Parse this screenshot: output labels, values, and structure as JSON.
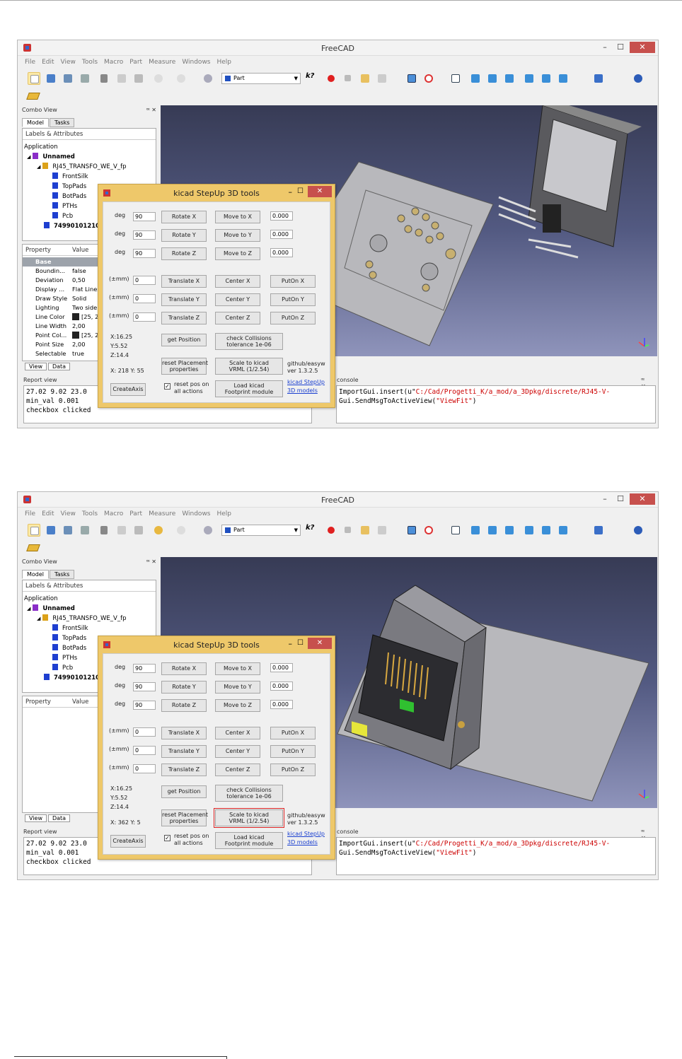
{
  "window": {
    "title": "FreeCAD",
    "min": "–",
    "max": "☐",
    "close": "✕"
  },
  "menu": [
    "File",
    "Edit",
    "View",
    "Tools",
    "Macro",
    "Part",
    "Measure",
    "Windows",
    "Help"
  ],
  "toolbar": {
    "workbench": "Part"
  },
  "combo_view": {
    "title": "Combo View",
    "buttons": "ꟹ ✕",
    "tabs": [
      "Model",
      "Tasks"
    ],
    "tree_header": "Labels & Attributes",
    "tree": {
      "application": "Application",
      "document": "Unnamed",
      "part": "RJ45_TRANSFO_WE_V_fp",
      "children": [
        "FrontSilk",
        "TopPads",
        "BotPads",
        "PTHs",
        "Pcb"
      ],
      "shape": "74990101210"
    },
    "property_header": {
      "property": "Property",
      "value": "Value"
    },
    "properties": [
      {
        "name": "Base",
        "value": ""
      },
      {
        "name": "Boundin...",
        "value": "false"
      },
      {
        "name": "Deviation",
        "value": "0,50"
      },
      {
        "name": "Display ...",
        "value": "Flat Lines"
      },
      {
        "name": "Draw Style",
        "value": "Solid"
      },
      {
        "name": "Lighting",
        "value": "Two side"
      },
      {
        "name": "Line Color",
        "value": "[25, 2"
      },
      {
        "name": "Line Width",
        "value": "2,00"
      },
      {
        "name": "Point Col...",
        "value": "[25, 2"
      },
      {
        "name": "Point Size",
        "value": "2,00"
      },
      {
        "name": "Selectable",
        "value": "true"
      }
    ],
    "bottom_tabs": [
      "View",
      "Data"
    ]
  },
  "report": {
    "title": "Report view",
    "lines": [
      "27.02 9.02 23.0",
      "min_val 0.001",
      "checkbox clicked"
    ]
  },
  "console": {
    "title": "console",
    "line1_prefix": "ImportGui.insert(u\"",
    "line1_path": "C:/Cad/Progetti_K/a_mod/a_3Dpkg/discrete/RJ45-V-",
    "line2_prefix": "Gui.SendMsgToActiveView(",
    "line2_arg": "\"ViewFit\"",
    "line2_suffix": ")"
  },
  "dialog": {
    "title": "kicad StepUp 3D tools",
    "deg": "deg",
    "mm": "(±mm)",
    "rot_values": [
      "90",
      "90",
      "90"
    ],
    "rot_buttons": [
      "Rotate X",
      "Rotate Y",
      "Rotate Z"
    ],
    "move_buttons": [
      "Move to X",
      "Move to Y",
      "Move to Z"
    ],
    "move_values": [
      "0.000",
      "0.000",
      "0.000"
    ],
    "trans_values": [
      "0",
      "0",
      "0"
    ],
    "trans_buttons": [
      "Translate X",
      "Translate Y",
      "Translate Z"
    ],
    "center_buttons": [
      "Center X",
      "Center Y",
      "Center Z"
    ],
    "puton_buttons": [
      "PutOn X",
      "PutOn Y",
      "PutOn Z"
    ],
    "pos_x": "X:16.25",
    "pos_y": "Y:5.52",
    "pos_z": "Z:14.4",
    "get_position": "get Position",
    "check_collisions_1": "check Collisions",
    "check_collisions_2": "tolerance 1e-06",
    "reset_placement_1": "reset Placement",
    "reset_placement_2": "properties",
    "scale_1": "Scale to kicad",
    "scale_2": "VRML (1/2.54)",
    "github_1": "github/easyw",
    "github_2": "ver 1.3.2.5",
    "create_axis": "CreateAxis",
    "reset_pos_1": "reset pos on",
    "reset_pos_2": "all actions",
    "load_kicad_1": "Load kicad",
    "load_kicad_2": "Footprint module",
    "link_stepup": "kicad StepUp",
    "link_models": "3D models"
  },
  "shot1": {
    "mouse": "X: 218 Y: 55"
  },
  "shot2": {
    "mouse": "X: 362 Y: 5"
  }
}
